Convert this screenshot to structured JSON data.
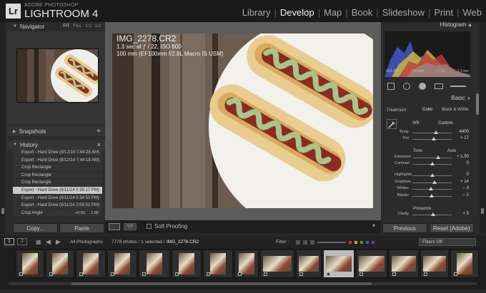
{
  "app": {
    "logo": "Lr",
    "brand_small": "ADOBE PHOTOSHOP",
    "brand": "LIGHTROOM 4",
    "modules": [
      "Library",
      "Develop",
      "Map",
      "Book",
      "Slideshow",
      "Print",
      "Web"
    ],
    "active_module": "Develop"
  },
  "left": {
    "navigator": {
      "title": "Navigator",
      "opts": [
        "FIT",
        "FILL",
        "1:1",
        "1:2"
      ]
    },
    "snapshots": {
      "title": "Snapshots",
      "add": "+"
    },
    "history": {
      "title": "History",
      "close": "×",
      "items": [
        {
          "label": "Export - Hard Drive (8/12/14 7:44:28 AM)",
          "v1": "",
          "v2": ""
        },
        {
          "label": "Export - Hard Drive (8/12/14 7:44:19 AM)",
          "v1": "",
          "v2": ""
        },
        {
          "label": "Crop Rectangle",
          "v1": "",
          "v2": ""
        },
        {
          "label": "Crop Rectangle",
          "v1": "",
          "v2": ""
        },
        {
          "label": "Crop Rectangle",
          "v1": "",
          "v2": ""
        },
        {
          "label": "Export - Hard Drive (8/11/14 5:35:17 PM)",
          "v1": "",
          "v2": ""
        },
        {
          "label": "Export - Hard Drive (8/11/14 5:34:53 PM)",
          "v1": "",
          "v2": ""
        },
        {
          "label": "Export - Hard Drive (8/11/14 2:05:52 PM)",
          "v1": "",
          "v2": ""
        },
        {
          "label": "Crop Angle",
          "v1": "+0.50",
          "v2": "1.80"
        }
      ],
      "selected_index": 5
    },
    "copy_label": "Copy...",
    "paste_label": "Paste"
  },
  "center": {
    "info_title": "IMG_2278.CR2",
    "info_line1": "1.3 sec at ƒ / 22, ISO 800",
    "info_line2": "100 mm (EF100mm f/2.8L Macro IS USM)",
    "soft_proofing": "Soft Proofing"
  },
  "right": {
    "histogram": {
      "title": "Histogram",
      "iso": "ISO 800",
      "focal": "100 mm",
      "aperture": "ƒ / 22",
      "shutter": "1.3 sec"
    },
    "basic": {
      "title": "Basic",
      "treatment_label": "Treatment :",
      "color": "Color",
      "bw": "Black & White",
      "wb_label": "WB :",
      "wb_value": "Custom",
      "temp": {
        "label": "Temp",
        "value": "4400"
      },
      "tint": {
        "label": "Tint",
        "value": "+ 17"
      },
      "tone_label": "Tone",
      "auto": "Auto",
      "exposure": {
        "label": "Exposure",
        "value": "+ 1.50"
      },
      "contrast": {
        "label": "Contrast",
        "value": "0"
      },
      "highlights": {
        "label": "Highlights",
        "value": "0"
      },
      "shadows": {
        "label": "Shadows",
        "value": "+ 14"
      },
      "whites": {
        "label": "Whites",
        "value": "− 3"
      },
      "blacks": {
        "label": "Blacks",
        "value": "− 2"
      },
      "presence_label": "Presence",
      "clarity": {
        "label": "Clarity",
        "value": "+ 5"
      }
    },
    "previous_label": "Previous",
    "reset_label": "Reset (Adobe)"
  },
  "filmstrip": {
    "pages": [
      "1",
      "2"
    ],
    "source": "All Photographs",
    "count": "7778 photos / 1 selected /",
    "filename": "IMG_2278.CR2",
    "filter_label": "Filter :",
    "filters_off": "Filters Off"
  },
  "colors": {
    "accent": "#f0f0f0",
    "panel": "#2b2b2b",
    "background": "#5c5c5c"
  }
}
